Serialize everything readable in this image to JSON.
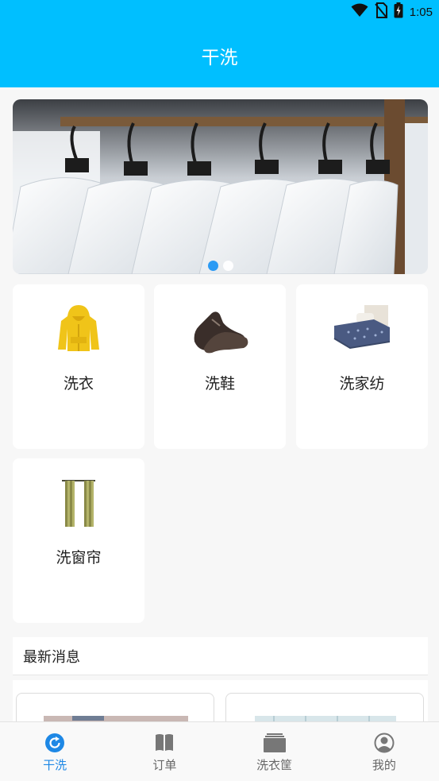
{
  "status_bar": {
    "time": "1:05",
    "icons": [
      "wifi-icon",
      "no-sim-icon",
      "battery-charging-icon"
    ]
  },
  "app_bar": {
    "title": "干洗"
  },
  "banner": {
    "image": "white-shirts-on-rack",
    "pages": 2,
    "active_page": 1
  },
  "services": [
    {
      "label": "洗衣",
      "icon": "yellow-hoodie-icon"
    },
    {
      "label": "洗鞋",
      "icon": "leather-shoes-icon"
    },
    {
      "label": "洗家纺",
      "icon": "bed-icon"
    },
    {
      "label": "洗窗帘",
      "icon": "curtain-icon"
    }
  ],
  "news": {
    "title": "最新消息"
  },
  "tabs": [
    {
      "label": "干洗",
      "icon": "refresh-icon",
      "active": true
    },
    {
      "label": "订单",
      "icon": "book-icon",
      "active": false
    },
    {
      "label": "洗衣筐",
      "icon": "basket-icon",
      "active": false
    },
    {
      "label": "我的",
      "icon": "user-icon",
      "active": false
    }
  ],
  "colors": {
    "primary": "#00bfff",
    "tab_active": "#1e88e5",
    "dot_active": "#2196f3"
  }
}
